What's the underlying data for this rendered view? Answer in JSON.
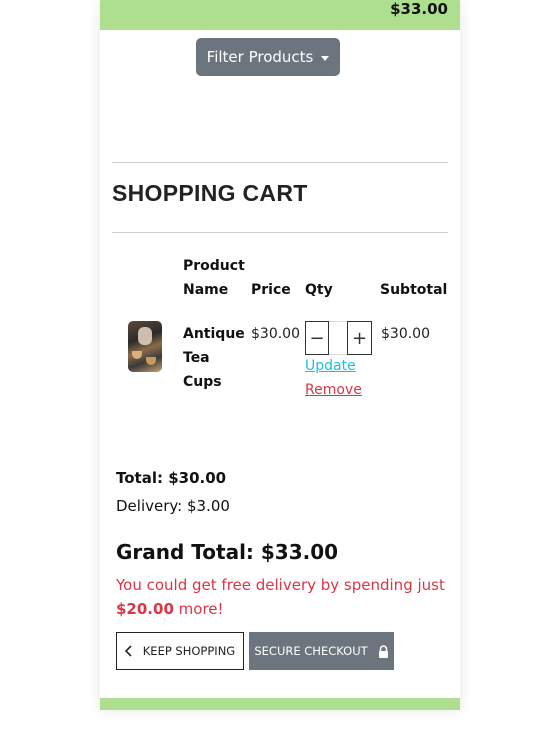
{
  "header": {
    "total": "$33.00"
  },
  "filter": {
    "label": "Filter Products",
    "icon": "caret-down-icon"
  },
  "cart": {
    "title": "SHOPPING CART",
    "columns": {
      "product_line1": "Product",
      "product_line2": "Name",
      "price": "Price",
      "qty": "Qty",
      "subtotal": "Subtotal"
    },
    "items": [
      {
        "name_line1": "Antique",
        "name_line2": "Tea",
        "name_line3": "Cups",
        "price": "$30.00",
        "qty_minus": "−",
        "qty_plus": "+",
        "update": "Update",
        "remove": "Remove",
        "subtotal": "$30.00"
      }
    ]
  },
  "summary": {
    "total": "Total: $30.00",
    "delivery": "Delivery: $3.00",
    "grand_total": "Grand Total: $33.00",
    "free_delivery_prefix": "You could get free delivery by spending just",
    "free_delivery_amount": "$20.00",
    "free_delivery_suffix": "more!"
  },
  "actions": {
    "keep_shopping": "KEEP SHOPPING",
    "secure_checkout": "SECURE CHECKOUT"
  },
  "colors": {
    "accent_green": "#aedf8f",
    "button_gray": "#6c757d",
    "danger": "#dc3545",
    "link_cyan": "#17c1e8"
  }
}
